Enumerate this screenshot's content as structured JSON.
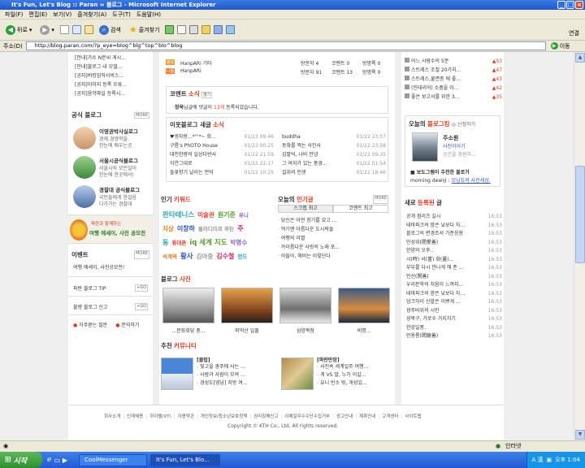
{
  "window": {
    "title": "It's Fun, Let's Blog :: Paran ∞ 블로그 - Microsoft Internet Explorer"
  },
  "menu": [
    "파일(F)",
    "편집(E)",
    "보기(V)",
    "즐겨찾기(A)",
    "도구(T)",
    "도움말(H)"
  ],
  "toolbar": {
    "back": "뒤로",
    "search": "검색",
    "favorites": "즐겨찾기"
  },
  "address": {
    "label": "주소(D)",
    "url": "http://blog.paran.com/?p_eye=blog^blg^top^blo^blog",
    "go": "이동",
    "links": "연결"
  },
  "left": {
    "notices": [
      "[안내]가수 N문씨 게시...",
      "[안내]블로그 내 모델...",
      "[공지]버킹엄직서비스...",
      "[공지]이미지 등록 오류...",
      "[공지]음악파일 등록시..."
    ],
    "official_title": "공식 블로그",
    "official_more": "MORE",
    "official": [
      {
        "name": "이영권박사실로그",
        "d1": "경제,경영학을",
        "d2": "한눈에 배우는곳"
      },
      {
        "name": "서울시공식블로그",
        "d1": "서울시의 모든일이",
        "d2": "한눈에 한곳에서!"
      },
      {
        "name": "경찰대 공식블로그",
        "d1": "국민들에게 한걸음",
        "d2": "다가가는 경찰대"
      }
    ],
    "banner1": "파란과 함께하는",
    "banner2": "여행 에세이, 사진 공모전",
    "event_title": "이벤트",
    "event_more": "MORE",
    "event_item": "여행 에세이, 사진공모전!",
    "tip": "파란 블로그 TIP",
    "report": "불량 블로그 신고",
    "faq": "자주묻는 질문",
    "ask": "문의하기"
  },
  "center": {
    "top_rows": [
      {
        "icon": "정보",
        "name": "HanpARi 기타",
        "v": "방문자 4",
        "c": "코멘트 0",
        "t": "방명록 0"
      },
      {
        "icon": "나름",
        "name": "HanpARi",
        "v": "방문자 91",
        "c": "코멘트 13",
        "t": "방명록 0"
      }
    ],
    "comment_title1": "코멘트",
    "comment_title2": "소식",
    "comment_btn": "열기",
    "comment_text1": "창욱",
    "comment_text2": "님글에 댓글이",
    "comment_text3": "13개",
    "comment_text4": "등록되었습니다.",
    "neighbor_title1": "이웃블로그 새글",
    "neighbor_title2": "소식",
    "neighbor_left": [
      {
        "t": "♥생자랑...*'''*~ 희...",
        "d": "01/23 09:46"
      },
      {
        "t": "구름's PhOTO House",
        "d": "01/23 00:25"
      },
      {
        "t": "대전한량의 일상다반사",
        "d": "01/22 21:59"
      },
      {
        "t": "자연그대로",
        "d": "01/22 22:17"
      },
      {
        "t": "들꽃향기 날리는 언덕",
        "d": "01/22 10:25"
      }
    ],
    "neighbor_right": [
      {
        "t": "buddha",
        "d": "01/22 23:57"
      },
      {
        "t": "동화를 찍는 사진사",
        "d": "01/22 23:58"
      },
      {
        "t": "김팔덕, 나비 안녕",
        "d": "01/22 09:35"
      },
      {
        "t": "그 여자가 있는 풍경...",
        "d": "01/22 01:54"
      },
      {
        "t": "길위의 인생",
        "d": "01/22 18:46"
      }
    ],
    "keyword_title1": "인기",
    "keyword_title2": "키워드",
    "keywords": [
      [
        "판타테니스",
        "미술관",
        "원기준",
        "유니"
      ],
      [
        "지상",
        "이창하",
        "블라디미르 푸틴",
        "주"
      ],
      [
        "동",
        "휴대폰",
        "iq 세계 지도",
        "박명수"
      ],
      [
        "석계역",
        "황사",
        "김아중",
        "김수철",
        "펀드"
      ]
    ],
    "today_title1": "오늘의",
    "today_title2": "인기글",
    "today_more": "MORE",
    "today_tab1": "스크랩 최고",
    "today_tab2": "코멘트 최고",
    "today_list": [
      "당신은 어떤 향기를 갖고 ...",
      "먹기엔 아름다운 도시락들",
      "여행의 이별",
      "카이름다운 사랑의 노래 포...",
      "아들아, 해비는 이렇단다"
    ],
    "photo_title1": "블로그",
    "photo_title2": "사진",
    "photos": [
      "...문화회담 중...",
      "떠먹산 일출",
      "삼양목장",
      "비명..."
    ],
    "comm_title1": "추천",
    "comm_title2": "커뮤니티",
    "comm_left_title": "[클럽]",
    "comm_left": [
      "빛고을 광주에 사는 ...",
      "사람과 사람이 모여 ...",
      "경성도[영남] 지방 여..."
    ],
    "comm_right_title": "[파란만장]",
    "comm_right": [
      "사진속 세계일주 여행...",
      "게 VS 말, 누가 이길...",
      "유니 빈소 밖, 개성있..."
    ]
  },
  "right": {
    "top_list": [
      {
        "t": "어느 사람수의 5분",
        "n": "53"
      },
      {
        "t": "스트레스 조절 20가지...",
        "n": "47"
      },
      {
        "t": "스트레스,불면증 에 좋...",
        "n": "43"
      },
      {
        "t": "(인테리어) 소품을 이...",
        "n": "42"
      },
      {
        "t": "좋은 보고서를 위한 3...",
        "n": "35"
      }
    ],
    "blogger_title1": "오늘의",
    "blogger_title2": "블로그킹",
    "blogger_sub": "산정하기",
    "blogger_name": "주소원",
    "blogger_blog": "사진이이기",
    "blogger_desc": "공간을 영원히...",
    "blogger_post1": "보도그램이 추천한 블로거",
    "blogger_post2": "morning dew님",
    "blogger_post3": "모닝듀의 사진세상.",
    "new_title1": "새로",
    "new_title2": "등록된",
    "new_title3": "글",
    "new_list": [
      {
        "t": "공개 점리즈 실시",
        "d": "16:53"
      },
      {
        "t": "테마파크의 밤은 낮보다 차...",
        "d": "16:53"
      },
      {
        "t": "블로그의 변경조서 기준응용",
        "d": "16:53"
      },
      {
        "t": "민성위(閔愛善)",
        "d": "16:53"
      },
      {
        "t": "한양의 오후..",
        "d": "16:53"
      },
      {
        "t": "시(時) 서(書) 화(畫)...",
        "d": "16:53"
      },
      {
        "t": "부부를 다시 만나게 해 준 ...",
        "d": "16:53"
      },
      {
        "t": "민선(閔善)",
        "d": "16:53"
      },
      {
        "t": "우리문학의 처음이 느껴지...",
        "d": "16:53"
      },
      {
        "t": "테마파크의 밤은 낮보다 차...",
        "d": "16:53"
      },
      {
        "t": "덩크하이 신발은 이쁘게 ...",
        "d": "16:53"
      },
      {
        "t": "광주바위의 시민",
        "d": "16:53"
      },
      {
        "t": "성북구, 가로수 가지치기",
        "d": "16:53"
      },
      {
        "t": "한강일풍..",
        "d": "16:53"
      },
      {
        "t": "민용룡(閔龍善)",
        "d": "16:53"
      }
    ]
  },
  "footer": {
    "links": [
      "회사소개",
      "인재채용",
      "하이텔(VT)",
      "이용약관",
      "개인정보/청소년보호정책",
      "권리침해신고",
      "이메일무수수단수집거부",
      "광고안내",
      "제휴안내",
      "고객센터",
      "사이트맵"
    ],
    "copyright": "Copyright © KTH Co., Ltd. All rights reserved."
  },
  "status": {
    "zone": "인터넷"
  },
  "taskbar": {
    "start": "시작",
    "tasks": [
      "CoolMessenger",
      "It's Fun, Let's Blo..."
    ],
    "lang": "A 漢",
    "clock": "오후 1:04"
  },
  "colors": {
    "accent_red": "#e23a1f",
    "ie_blue": "#2459d4",
    "link_blue": "#2c53b3"
  }
}
